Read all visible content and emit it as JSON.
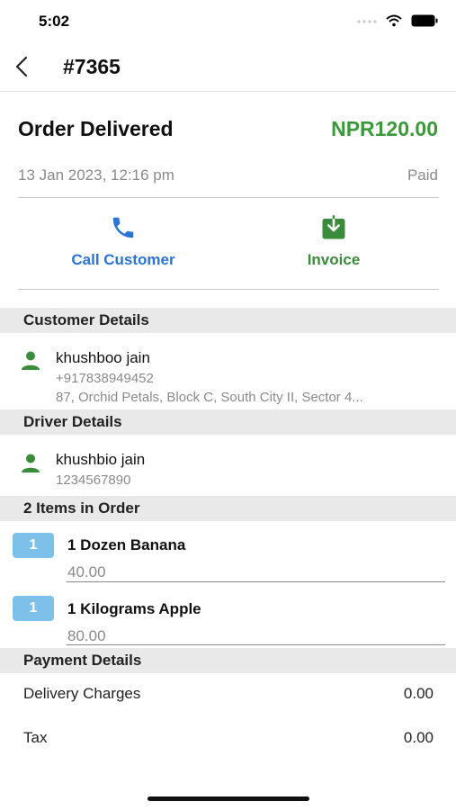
{
  "status_bar": {
    "time": "5:02"
  },
  "nav": {
    "title": "#7365"
  },
  "order": {
    "status": "Order Delivered",
    "amount": "NPR120.00",
    "date": "13 Jan 2023, 12:16 pm",
    "payment_status": "Paid"
  },
  "actions": {
    "call_label": "Call Customer",
    "invoice_label": "Invoice"
  },
  "customer": {
    "heading": "Customer Details",
    "name": "khushboo jain",
    "phone": "+917838949452",
    "address": "87, Orchid Petals, Block C, South City II, Sector 4..."
  },
  "driver": {
    "heading": "Driver Details",
    "name": "khushbio jain",
    "phone": "1234567890"
  },
  "items": {
    "heading": "2 Items in Order",
    "list": [
      {
        "qty": "1",
        "name": "1 Dozen Banana",
        "price": "40.00"
      },
      {
        "qty": "1",
        "name": "1 Kilograms Apple",
        "price": "80.00"
      }
    ]
  },
  "payment": {
    "heading": "Payment Details",
    "rows": [
      {
        "label": "Delivery Charges",
        "value": "0.00"
      },
      {
        "label": "Tax",
        "value": "0.00"
      }
    ]
  },
  "colors": {
    "amount_green": "#3a9a3a",
    "call_blue": "#2b73d6",
    "invoice_green": "#3a8c3a",
    "qty_badge": "#7dc0ea"
  }
}
